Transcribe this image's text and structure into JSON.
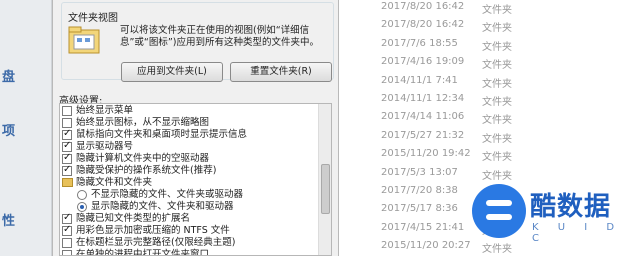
{
  "left_strip": {
    "items": [
      "盘",
      "项",
      "性"
    ]
  },
  "dialog": {
    "folder_view": {
      "title": "文件夹视图",
      "description": "可以将该文件夹正在使用的视图(例如“详细信息”或“图标”)应用到所有这种类型的文件夹中。",
      "apply_button": "应用到文件夹(L)",
      "reset_button": "重置文件夹(R)"
    },
    "advanced_label": "高级设置:",
    "advanced_items": [
      {
        "type": "checkbox",
        "checked": false,
        "label": "始终显示菜单"
      },
      {
        "type": "checkbox",
        "checked": false,
        "label": "始终显示图标，从不显示缩略图"
      },
      {
        "type": "checkbox",
        "checked": true,
        "label": "鼠标指向文件夹和桌面项时显示提示信息"
      },
      {
        "type": "checkbox",
        "checked": true,
        "label": "显示驱动器号"
      },
      {
        "type": "checkbox",
        "checked": true,
        "label": "隐藏计算机文件夹中的空驱动器"
      },
      {
        "type": "checkbox",
        "checked": true,
        "label": "隐藏受保护的操作系统文件(推荐)"
      },
      {
        "type": "folder",
        "label": "隐藏文件和文件夹"
      },
      {
        "type": "radio",
        "selected": false,
        "label": "不显示隐藏的文件、文件夹或驱动器"
      },
      {
        "type": "radio",
        "selected": true,
        "label": "显示隐藏的文件、文件夹和驱动器"
      },
      {
        "type": "checkbox",
        "checked": true,
        "label": "隐藏已知文件类型的扩展名"
      },
      {
        "type": "checkbox",
        "checked": true,
        "label": "用彩色显示加密或压缩的 NTFS 文件"
      },
      {
        "type": "checkbox",
        "checked": false,
        "label": "在标题栏显示完整路径(仅限经典主题)"
      },
      {
        "type": "checkbox",
        "checked": false,
        "label": "在单独的进程中打开文件夹窗口"
      }
    ]
  },
  "file_list": [
    {
      "date": "2017/8/20 16:42",
      "type": "文件夹"
    },
    {
      "date": "2017/8/20 16:42",
      "type": "文件夹"
    },
    {
      "date": "2017/7/6 18:55",
      "type": "文件夹"
    },
    {
      "date": "2017/4/16 19:09",
      "type": "文件夹"
    },
    {
      "date": "2014/11/1 7:41",
      "type": "文件夹"
    },
    {
      "date": "2014/11/1 12:34",
      "type": "文件夹"
    },
    {
      "date": "2017/4/14 11:06",
      "type": "文件夹"
    },
    {
      "date": "2017/5/27 21:32",
      "type": "文件夹"
    },
    {
      "date": "2015/11/20 19:42",
      "type": "文件夹"
    },
    {
      "date": "2017/5/3 13:07",
      "type": "文件夹"
    },
    {
      "date": "2017/7/20 8:38",
      "type": "文件夹"
    },
    {
      "date": "2017/5/17 8:36",
      "type": "文件夹"
    },
    {
      "date": "2017/4/15 21:41",
      "type": "文件夹"
    },
    {
      "date": "2015/11/20 20:27",
      "type": "文件夹"
    }
  ],
  "watermark": {
    "brand": "酷数据",
    "sub": "K U I D C",
    "color": "#2a79e3"
  }
}
